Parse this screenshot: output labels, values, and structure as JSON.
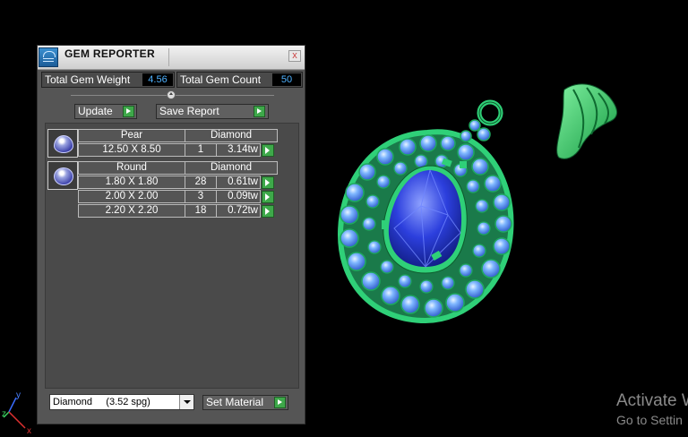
{
  "window": {
    "title": "GEM REPORTER",
    "close_label": "x"
  },
  "stats": {
    "weight_label": "Total Gem Weight",
    "weight_value": "4.56",
    "count_label": "Total Gem Count",
    "count_value": "50"
  },
  "toolbar": {
    "update_label": "Update",
    "save_report_label": "Save Report"
  },
  "gem_groups": [
    {
      "shape": "Pear",
      "material": "Diamond",
      "rows": [
        {
          "size": "12.50 X 8.50",
          "count": "1",
          "weight": "3.14tw"
        }
      ]
    },
    {
      "shape": "Round",
      "material": "Diamond",
      "rows": [
        {
          "size": "1.80 X 1.80",
          "count": "28",
          "weight": "0.61tw"
        },
        {
          "size": "2.00 X 2.00",
          "count": "3",
          "weight": "0.09tw"
        },
        {
          "size": "2.20 X 2.20",
          "count": "18",
          "weight": "0.72tw"
        }
      ]
    }
  ],
  "material_select": {
    "value": "Diamond     (3.52 spg)"
  },
  "set_material_label": "Set Material",
  "axes": {
    "y": "y",
    "z": "z",
    "x": "x"
  },
  "watermark": {
    "line1": "Activate W",
    "line2": "Go to Settin"
  },
  "colors": {
    "panel_bg": "#555555",
    "accent_green": "#3ea84a",
    "value_blue": "#4fb2ff",
    "metal_green": "#2fd078",
    "gem_blue": "#2f3fd8"
  },
  "icons": [
    "app-icon",
    "close-icon",
    "play-icon",
    "gem-thumbnail-icon",
    "dropdown-arrow-icon",
    "axis-gizmo-icon"
  ]
}
